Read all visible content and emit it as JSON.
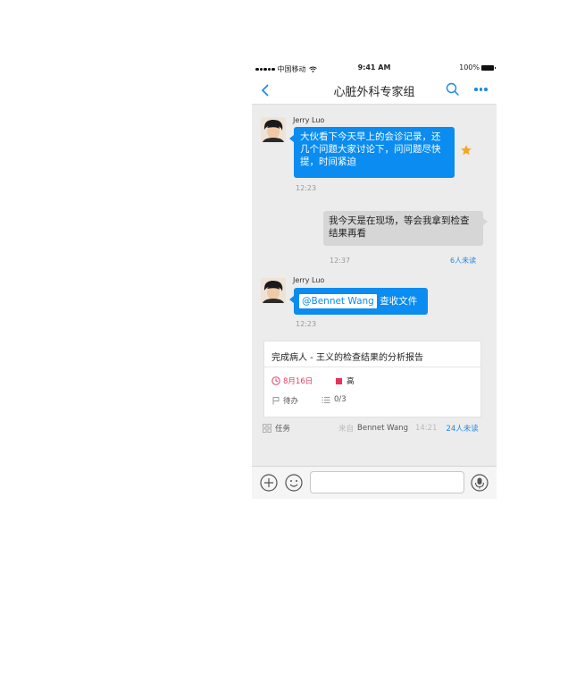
{
  "status_bar": {
    "carrier": "中国移动",
    "time": "9:41 AM",
    "battery": "100%"
  },
  "nav": {
    "title": "心脏外科专家组",
    "back_icon": "chevron-left-icon",
    "search_icon": "search-icon",
    "more_icon": "more-dots-icon",
    "accent_color": "#1e88e5"
  },
  "messages": [
    {
      "sender": "Jerry Luo",
      "text": "大伙看下今天早上的会诊记录，还几个问题大家讨论下，问问题尽快提，时间紧迫",
      "time": "12:23",
      "starred": true
    },
    {
      "sender": "me",
      "text": "我今天是在现场，等会我拿到检查结果再看",
      "time": "12:37",
      "unread": "6人未读"
    },
    {
      "sender": "Jerry Luo",
      "mention": "@Bennet Wang",
      "text": "查收文件",
      "time": "12:23"
    }
  ],
  "task_card": {
    "title": "完成病人 - 王义的检查结果的分析报告",
    "date": "8月16日",
    "priority": "高",
    "status": "待办",
    "subtasks": "0/3",
    "priority_color": "#e8305a"
  },
  "task_footer": {
    "type": "任务",
    "from_label": "来自",
    "from_name": "Bennet Wang",
    "time": "14:21",
    "unread": "24人未读"
  },
  "input_bar": {
    "add_icon": "plus-circle-icon",
    "emoji_icon": "smiley-icon",
    "voice_icon": "microphone-icon",
    "placeholder": ""
  }
}
